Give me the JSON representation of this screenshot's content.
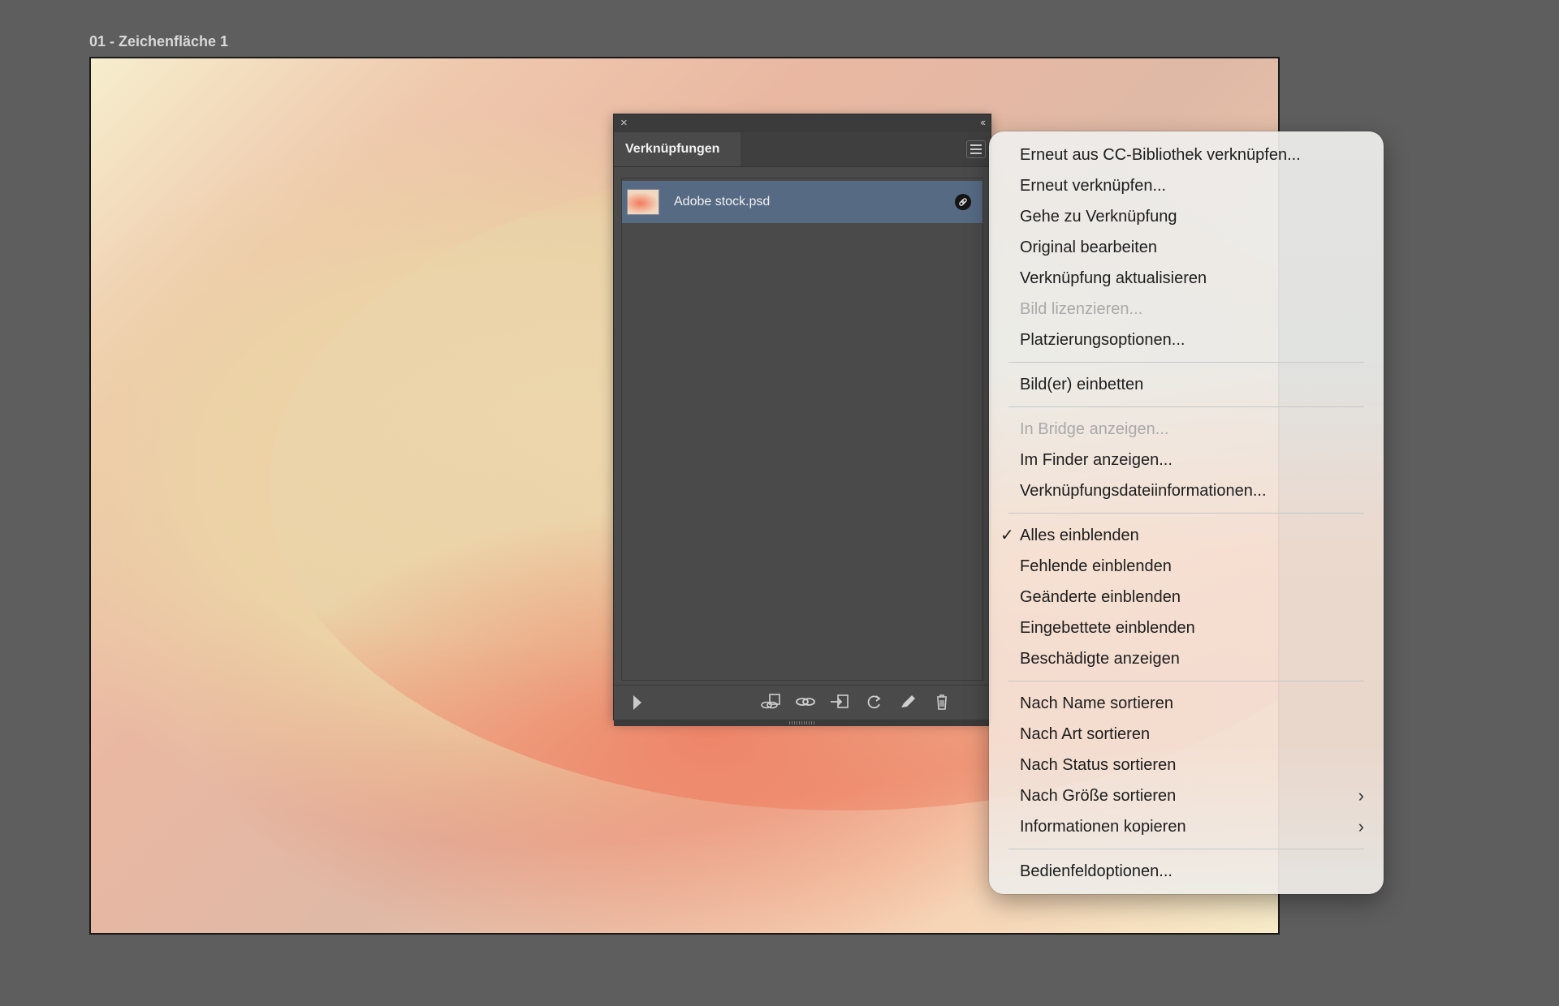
{
  "artboard": {
    "label": "01 - Zeichenfläche 1"
  },
  "panel": {
    "close_icon": "×",
    "collapse_icon": "‹‹",
    "tab_label": "Verknüpfungen",
    "items": [
      {
        "name": "Adobe stock.psd",
        "status_icon": "🔗"
      }
    ]
  },
  "menu": {
    "groups": [
      [
        {
          "label": "Erneut aus CC-Bibliothek verknüpfen...",
          "enabled": true
        },
        {
          "label": "Erneut verknüpfen...",
          "enabled": true
        },
        {
          "label": "Gehe zu Verknüpfung",
          "enabled": true
        },
        {
          "label": "Original bearbeiten",
          "enabled": true
        },
        {
          "label": "Verknüpfung aktualisieren",
          "enabled": true
        },
        {
          "label": "Bild lizenzieren...",
          "enabled": false
        },
        {
          "label": "Platzierungsoptionen...",
          "enabled": true
        }
      ],
      [
        {
          "label": "Bild(er) einbetten",
          "enabled": true
        }
      ],
      [
        {
          "label": "In Bridge anzeigen...",
          "enabled": false
        },
        {
          "label": "Im Finder anzeigen...",
          "enabled": true
        },
        {
          "label": "Verknüpfungsdateiinformationen...",
          "enabled": true
        }
      ],
      [
        {
          "label": "Alles einblenden",
          "enabled": true,
          "checked": true
        },
        {
          "label": "Fehlende einblenden",
          "enabled": true
        },
        {
          "label": "Geänderte einblenden",
          "enabled": true
        },
        {
          "label": "Eingebettete einblenden",
          "enabled": true
        },
        {
          "label": "Beschädigte anzeigen",
          "enabled": true
        }
      ],
      [
        {
          "label": "Nach Name sortieren",
          "enabled": true
        },
        {
          "label": "Nach Art sortieren",
          "enabled": true
        },
        {
          "label": "Nach Status sortieren",
          "enabled": true
        },
        {
          "label": "Nach Größe sortieren",
          "enabled": true,
          "submenu": true
        },
        {
          "label": "Informationen kopieren",
          "enabled": true,
          "submenu": true
        }
      ],
      [
        {
          "label": "Bedienfeldoptionen...",
          "enabled": true
        }
      ]
    ],
    "check_glyph": "✓",
    "submenu_glyph": "›"
  }
}
